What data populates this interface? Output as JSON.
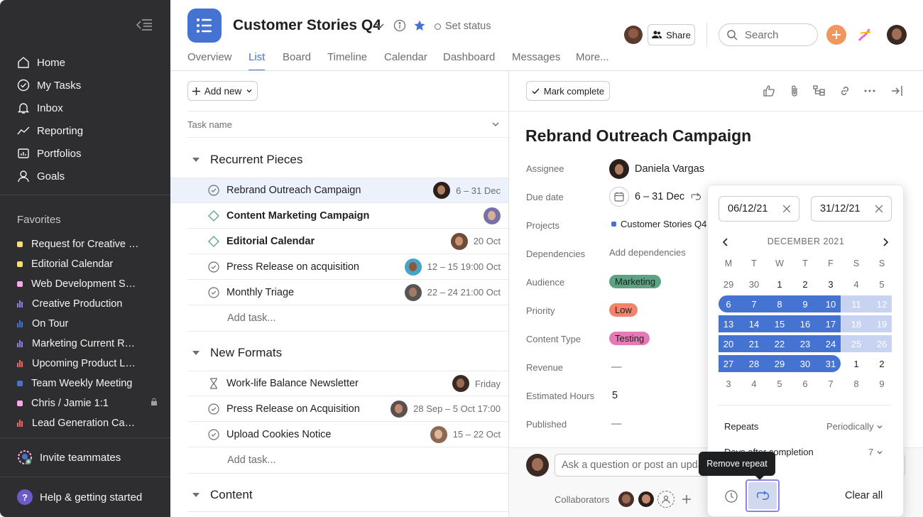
{
  "sidebar": {
    "nav": [
      {
        "label": "Home",
        "icon": "home-icon"
      },
      {
        "label": "My Tasks",
        "icon": "check-circle-icon"
      },
      {
        "label": "Inbox",
        "icon": "bell-icon"
      },
      {
        "label": "Reporting",
        "icon": "chart-line-icon"
      },
      {
        "label": "Portfolios",
        "icon": "portfolio-icon"
      },
      {
        "label": "Goals",
        "icon": "goals-icon"
      }
    ],
    "favorites_title": "Favorites",
    "favorites": [
      {
        "label": "Request for Creative …",
        "color": "#f8df72",
        "type": "dot"
      },
      {
        "label": "Editorial Calendar",
        "color": "#f8df72",
        "type": "dot"
      },
      {
        "label": "Web Development Sp…",
        "color": "#f9aaef",
        "type": "dot"
      },
      {
        "label": "Creative Production",
        "color": "#8d84e8",
        "type": "bars"
      },
      {
        "label": "On Tour",
        "color": "#4573d2",
        "type": "bars"
      },
      {
        "label": "Marketing Current Ro…",
        "color": "#8d84e8",
        "type": "bars"
      },
      {
        "label": "Upcoming Product La…",
        "color": "#f06a6a",
        "type": "bars"
      },
      {
        "label": "Team Weekly Meeting",
        "color": "#4573d2",
        "type": "dot"
      },
      {
        "label": "Chris / Jamie 1:1",
        "color": "#f9aaef",
        "type": "dot"
      },
      {
        "label": "Lead Generation Cam…",
        "color": "#f06a6a",
        "type": "bars"
      }
    ],
    "invite": "Invite teammates",
    "help": "Help & getting started"
  },
  "header": {
    "title": "Customer Stories Q4",
    "set_status": "Set status",
    "share": "Share",
    "search_placeholder": "Search",
    "tabs": [
      "Overview",
      "List",
      "Board",
      "Timeline",
      "Calendar",
      "Dashboard",
      "Messages",
      "More..."
    ]
  },
  "list": {
    "add_new": "Add new",
    "column_task_name": "Task name",
    "add_task": "Add task...",
    "sections": [
      {
        "title": "Recurrent Pieces",
        "tasks": [
          {
            "name": "Rebrand Outreach Campaign",
            "date": "6 – 31 Dec",
            "bold": false,
            "icon": "check",
            "selected": true
          },
          {
            "name": "Content Marketing Campaign",
            "date": "",
            "bold": true,
            "icon": "diamond"
          },
          {
            "name": "Editorial Calendar",
            "date": "20 Oct",
            "bold": true,
            "icon": "diamond"
          },
          {
            "name": "Press Release on acquisition",
            "date": "12 – 15 19:00 Oct",
            "bold": false,
            "icon": "check"
          },
          {
            "name": "Monthly Triage",
            "date": "22 – 24 21:00 Oct",
            "bold": false,
            "icon": "check"
          }
        ]
      },
      {
        "title": "New Formats",
        "tasks": [
          {
            "name": "Work-life Balance Newsletter",
            "date": "Friday",
            "bold": false,
            "icon": "hourglass"
          },
          {
            "name": "Press Release on Acquisition",
            "date": "28 Sep – 5 Oct 17:00",
            "bold": false,
            "icon": "check"
          },
          {
            "name": "Upload Cookies Notice",
            "date": "15 – 22 Oct",
            "bold": false,
            "icon": "check"
          }
        ]
      },
      {
        "title": "Content",
        "tasks": []
      }
    ]
  },
  "detail": {
    "mark_complete": "Mark complete",
    "title": "Rebrand Outreach Campaign",
    "fields": {
      "assignee_label": "Assignee",
      "assignee": "Daniela Vargas",
      "due_label": "Due date",
      "due": "6 – 31 Dec",
      "projects_label": "Projects",
      "project": "Customer Stories Q4",
      "dependencies_label": "Dependencies",
      "dependencies": "Add dependencies",
      "audience_label": "Audience",
      "audience": "Marketing",
      "priority_label": "Priority",
      "priority": "Low",
      "content_type_label": "Content Type",
      "content_type": "Testing",
      "revenue_label": "Revenue",
      "revenue": "—",
      "hours_label": "Estimated Hours",
      "hours": "5",
      "published_label": "Published",
      "published": "—"
    },
    "comment_placeholder": "Ask a question or post an update...",
    "collaborators": "Collaborators"
  },
  "picker": {
    "start": "06/12/21",
    "end": "31/12/21",
    "month": "DECEMBER 2021",
    "dow": [
      "M",
      "T",
      "W",
      "T",
      "F",
      "S",
      "S"
    ],
    "weeks": [
      [
        "29",
        "30",
        "1",
        "2",
        "3",
        "4",
        "5"
      ],
      [
        "6",
        "7",
        "8",
        "9",
        "10",
        "11",
        "12"
      ],
      [
        "13",
        "14",
        "15",
        "16",
        "17",
        "18",
        "19"
      ],
      [
        "20",
        "21",
        "22",
        "23",
        "24",
        "25",
        "26"
      ],
      [
        "27",
        "28",
        "29",
        "30",
        "31",
        "1",
        "2"
      ],
      [
        "3",
        "4",
        "5",
        "6",
        "7",
        "8",
        "9"
      ]
    ],
    "repeats_label": "Repeats",
    "repeats_value": "Periodically",
    "days_after_label": "Days after completion",
    "days_after_value": "7",
    "tooltip": "Remove repeat",
    "clear_all": "Clear all"
  }
}
